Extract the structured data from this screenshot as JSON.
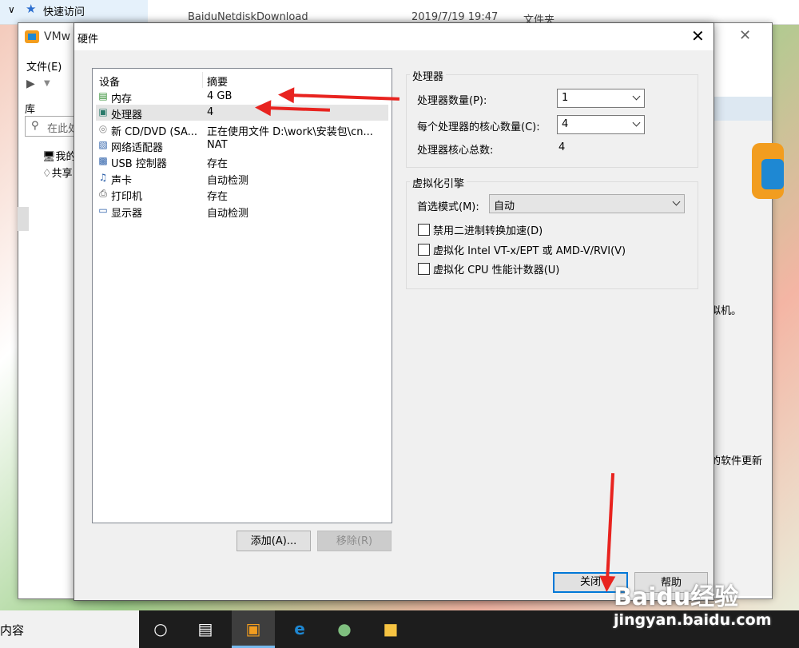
{
  "explorer": {
    "quick_access": "快速访问",
    "row_name": "BaiduNetdiskDownload",
    "row_date": "2019/7/19 19:47",
    "row_type": "文件夹"
  },
  "vmware": {
    "title": "VMw",
    "menu_file": "文件(E)",
    "library": "库",
    "search_placeholder": "在此处",
    "tree_my": "我的",
    "tree_shared": "共享",
    "right_text_1": "拟机。",
    "right_text_2": "的软件更新"
  },
  "dialog": {
    "title": "硬件",
    "col_device": "设备",
    "col_summary": "摘要",
    "devices": [
      {
        "icon": "memory-icon",
        "name": "内存",
        "summary": "4 GB"
      },
      {
        "icon": "processor-icon",
        "name": "处理器",
        "summary": "4"
      },
      {
        "icon": "cd-dvd-icon",
        "name": "新 CD/DVD (SA...",
        "summary": "正在使用文件 D:\\work\\安装包\\cn..."
      },
      {
        "icon": "network-icon",
        "name": "网络适配器",
        "summary": "NAT"
      },
      {
        "icon": "usb-icon",
        "name": "USB 控制器",
        "summary": "存在"
      },
      {
        "icon": "sound-icon",
        "name": "声卡",
        "summary": "自动检测"
      },
      {
        "icon": "printer-icon",
        "name": "打印机",
        "summary": "存在"
      },
      {
        "icon": "display-icon",
        "name": "显示器",
        "summary": "自动检测"
      }
    ],
    "add_button": "添加(A)...",
    "remove_button": "移除(R)",
    "processor_group": "处理器",
    "processor_count_label": "处理器数量(P):",
    "processor_count_value": "1",
    "cores_label": "每个处理器的核心数量(C):",
    "cores_value": "4",
    "total_cores_label": "处理器核心总数:",
    "total_cores_value": "4",
    "virt_group": "虚拟化引擎",
    "preferred_mode_label": "首选模式(M):",
    "preferred_mode_value": "自动",
    "check1": "禁用二进制转换加速(D)",
    "check2": "虚拟化 Intel VT-x/EPT 或 AMD-V/RVI(V)",
    "check3": "虚拟化 CPU 性能计数器(U)",
    "close_button": "关闭",
    "help_button": "帮助"
  },
  "taskbar": {
    "search_text": "内容"
  },
  "watermark": {
    "brand": "Baidu经验",
    "url": "jingyan.baidu.com"
  }
}
